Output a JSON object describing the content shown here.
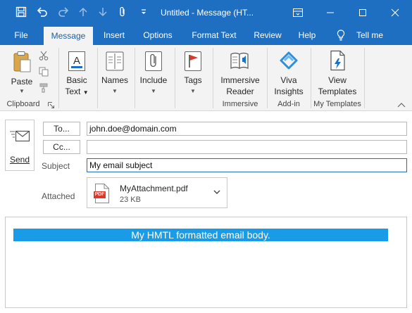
{
  "window": {
    "title": "Untitled  -  Message (HT..."
  },
  "tabs": [
    {
      "label": "File"
    },
    {
      "label": "Message"
    },
    {
      "label": "Insert"
    },
    {
      "label": "Options"
    },
    {
      "label": "Format Text"
    },
    {
      "label": "Review"
    },
    {
      "label": "Help"
    },
    {
      "label": "Tell me"
    }
  ],
  "ribbon": {
    "paste": "Paste",
    "clipboard": "Clipboard",
    "basic_text_1": "Basic",
    "basic_text_2": "Text",
    "names": "Names",
    "include": "Include",
    "tags": "Tags",
    "immersive_reader_1": "Immersive",
    "immersive_reader_2": "Reader",
    "immersive_group": "Immersive",
    "viva_1": "Viva",
    "viva_2": "Insights",
    "addin_group": "Add-in",
    "view_templates_1": "View",
    "view_templates_2": "Templates",
    "templates_group": "My Templates"
  },
  "compose": {
    "send": "Send",
    "to_button": "To...",
    "cc_button": "Cc...",
    "to_value": "john.doe@domain.com",
    "cc_value": "",
    "subject_label": "Subject",
    "subject_value": "My email subject",
    "attached_label": "Attached",
    "attachment_name": "MyAttachment.pdf",
    "attachment_size": "23 KB",
    "attachment_badge": "PDF",
    "body_text": "My HMTL formatted email body."
  },
  "colors": {
    "titlebar": "#1e6fc1",
    "accent": "#1e5fa8",
    "body_highlight": "#1a9be8",
    "pdf_red": "#d83b2b"
  },
  "icons": {
    "save": "save-icon",
    "undo": "undo-icon",
    "redo": "redo-icon",
    "up": "up-arrow-icon",
    "down": "down-arrow-icon",
    "attach": "paperclip-icon",
    "customize": "customize-qat-icon",
    "restore": "ribbon-display-icon",
    "minimize": "minimize-icon",
    "maximize": "maximize-icon",
    "close": "close-icon"
  }
}
